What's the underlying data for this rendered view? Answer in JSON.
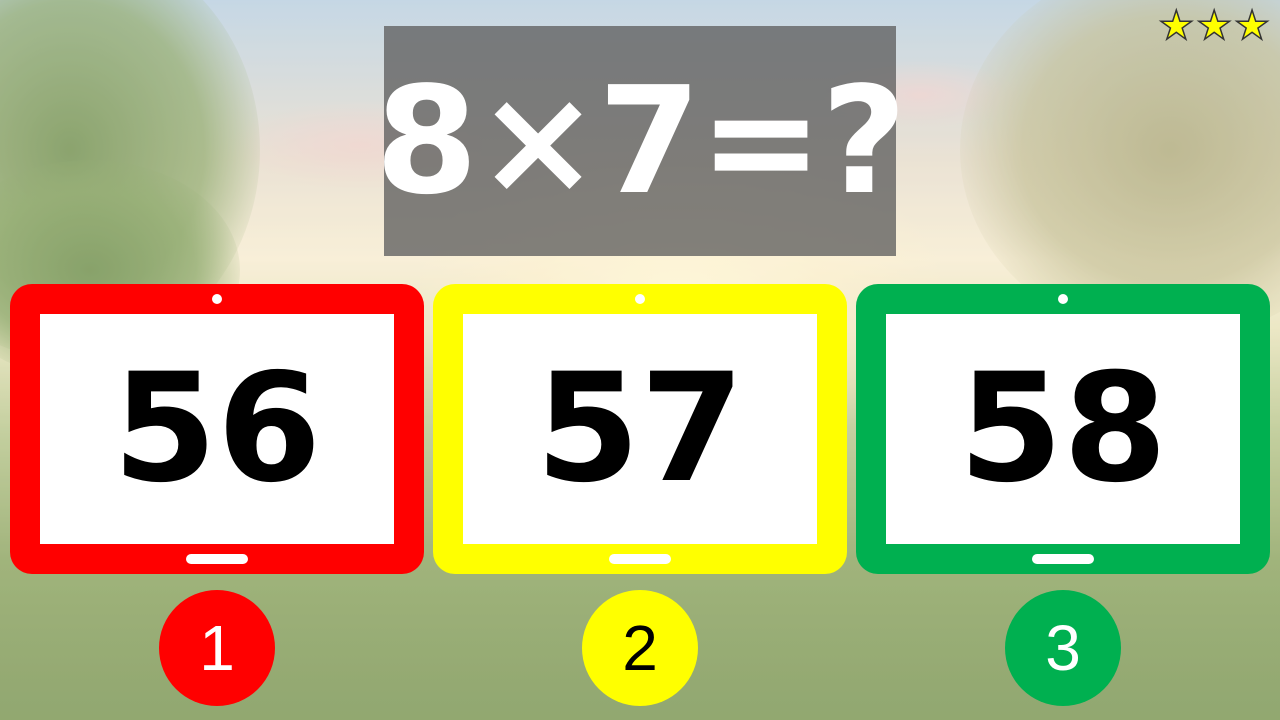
{
  "question": {
    "text": "8×7=?"
  },
  "rating": {
    "stars": "★★★",
    "star_color": "#ffff00"
  },
  "answers": [
    {
      "value": "56",
      "badge": "1",
      "color": "#ff0000",
      "badge_text_color": "#ffffff"
    },
    {
      "value": "57",
      "badge": "2",
      "color": "#ffff00",
      "badge_text_color": "#000000"
    },
    {
      "value": "58",
      "badge": "3",
      "color": "#00b050",
      "badge_text_color": "#ffffff"
    }
  ],
  "icons": {
    "tablet_frame": "tablet-icon",
    "rating": "star-icon"
  }
}
